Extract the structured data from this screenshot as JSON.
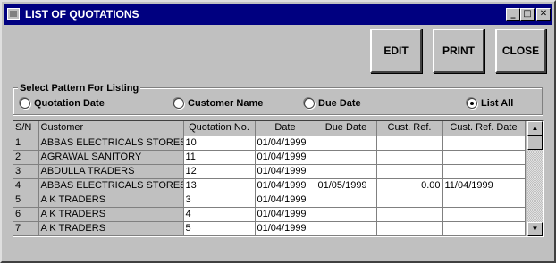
{
  "window": {
    "title": "LIST OF QUOTATIONS"
  },
  "titlebar_buttons": {
    "minimize": "_",
    "maximize": "□",
    "close": "✕"
  },
  "buttons": {
    "edit": "EDIT",
    "print": "PRINT",
    "close": "CLOSE"
  },
  "listing": {
    "group_label": "Select Pattern For Listing",
    "options": [
      {
        "label": "Quotation Date",
        "selected": false
      },
      {
        "label": "Customer Name",
        "selected": false
      },
      {
        "label": "Due Date",
        "selected": false
      },
      {
        "label": "List All",
        "selected": true
      }
    ]
  },
  "table": {
    "columns": [
      "S/N",
      "Customer",
      "Quotation No.",
      "Date",
      "Due Date",
      "Cust. Ref.",
      "Cust. Ref. Date"
    ],
    "rows": [
      [
        "1",
        "ABBAS ELECTRICALS STORES",
        "10",
        "01/04/1999",
        "",
        "",
        ""
      ],
      [
        "2",
        "AGRAWAL SANITORY",
        "11",
        "01/04/1999",
        "",
        "",
        ""
      ],
      [
        "3",
        "ABDULLA TRADERS",
        "12",
        "01/04/1999",
        "",
        "",
        ""
      ],
      [
        "4",
        "ABBAS ELECTRICALS STORES",
        "13",
        "01/04/1999",
        "01/05/1999",
        "0.00",
        "11/04/1999"
      ],
      [
        "5",
        "A K TRADERS",
        "3",
        "01/04/1999",
        "",
        "",
        ""
      ],
      [
        "6",
        "A K TRADERS",
        "4",
        "01/04/1999",
        "",
        "",
        ""
      ],
      [
        "7",
        "A K TRADERS",
        "5",
        "01/04/1999",
        "",
        "",
        ""
      ]
    ]
  },
  "scrollbar": {
    "up": "▲",
    "down": "▼"
  }
}
